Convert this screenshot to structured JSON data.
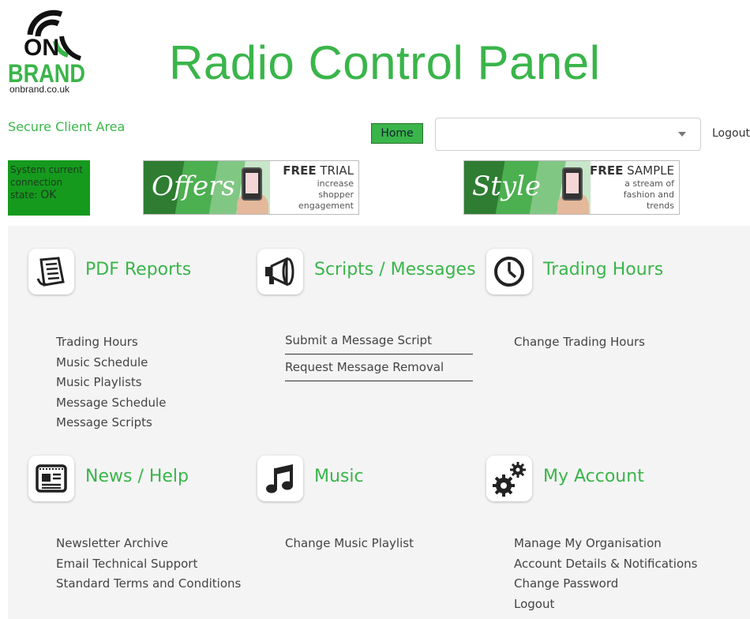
{
  "logo": {
    "line1": "ON",
    "line2": "BRAND",
    "subtext": "onbrand.co.uk"
  },
  "title": "Radio Control Panel",
  "secure_area": "Secure Client Area",
  "nav": {
    "home_label": "Home",
    "select_value": "",
    "logout_label": "Logout"
  },
  "connection": {
    "label": "System current connection state:",
    "state": "OK"
  },
  "banners": [
    {
      "word": "Offers",
      "head_bold": "FREE",
      "head_rest": " TRIAL",
      "lines": [
        "increase",
        "shopper",
        "engagement"
      ]
    },
    {
      "word": "Style",
      "head_bold": "FREE",
      "head_rest": " SAMPLE",
      "lines": [
        "a stream of",
        "fashion and",
        "trends"
      ]
    }
  ],
  "sections": [
    {
      "title": "PDF Reports",
      "icon": "document-icon",
      "links": [
        "Trading Hours",
        "Music Schedule",
        "Music Playlists",
        "Message Schedule",
        "Message Scripts"
      ]
    },
    {
      "title": "Scripts / Messages",
      "icon": "megaphone-icon",
      "links": [
        "Submit a Message Script",
        "Request Message Removal"
      ]
    },
    {
      "title": "Trading Hours",
      "icon": "clock-icon",
      "links": [
        "Change Trading Hours"
      ]
    },
    {
      "title": "News / Help",
      "icon": "newspaper-icon",
      "links": [
        "Newsletter Archive",
        "Email Technical Support",
        "Standard Terms and Conditions"
      ]
    },
    {
      "title": "Music",
      "icon": "music-note-icon",
      "links": [
        "Change Music Playlist"
      ]
    },
    {
      "title": "My Account",
      "icon": "gears-icon",
      "links": [
        "Manage My Organisation",
        "Account Details & Notifications",
        "Change Password",
        "Logout"
      ]
    }
  ],
  "colors": {
    "accent": "#3ab54a",
    "connection_bg": "#159a1e",
    "panel_bg": "#f4f4f4"
  }
}
